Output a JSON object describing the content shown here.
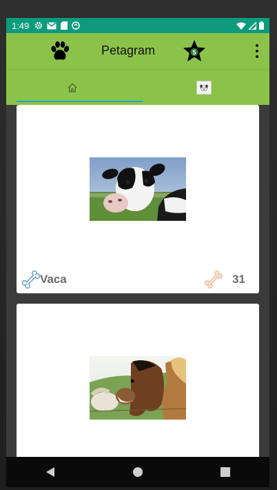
{
  "status_bar": {
    "time": "1:49",
    "left_icons": [
      "gear-icon",
      "gmail-icon",
      "sd-card-icon",
      "sync-icon"
    ],
    "right_icons": [
      "wifi-icon",
      "signal-icon",
      "battery-icon"
    ]
  },
  "toolbar": {
    "title": "Petagram",
    "star_badge": "5",
    "background_color": "#8bc34a"
  },
  "tabs": [
    {
      "icon": "home-icon",
      "selected": true
    },
    {
      "icon": "profile-dog-icon",
      "selected": false
    }
  ],
  "pets": [
    {
      "name": "Vaca",
      "likes": "31",
      "photo": "cow-photo"
    },
    {
      "name": "",
      "likes": "",
      "photo": "horse-photo"
    }
  ],
  "nav_bar": {
    "buttons": [
      "back-icon",
      "home-circle-icon",
      "recents-icon"
    ]
  },
  "colors": {
    "status_bar": "#0d9a7d",
    "accent_indicator": "#2aa4c8",
    "text_gray": "#6b6b6b"
  }
}
